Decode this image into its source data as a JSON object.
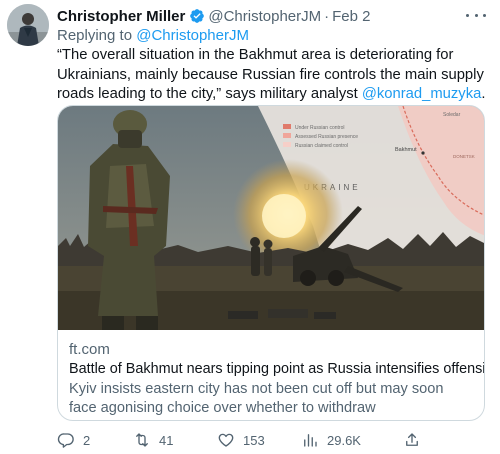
{
  "tweet": {
    "author_name": "Christopher Miller",
    "handle": "@ChristopherJM",
    "separator": "·",
    "date": "Feb 2",
    "reply_prefix": "Replying to",
    "reply_to": "@ChristopherJM",
    "text_main": "“The overall situation in the Bakhmut area is deteriorating for Ukrainians, mainly because Russian fire controls the main supply roads leading to the city,” says military analyst",
    "mention": "@konrad_muzyka",
    "text_end": ".",
    "verified_color": "#1d9bf0",
    "link_color": "#1d9bf0"
  },
  "card": {
    "domain": "ft.com",
    "title": "Battle of Bakhmut nears tipping point as Russia intensifies offensive",
    "description": "Kyiv insists eastern city has not been cut off but may soon face agonising choice over whether to withdraw",
    "map": {
      "country_label": "UKRAINE",
      "city_label": "Bakhmut",
      "legend_items": [
        "Under Russian control",
        "Assessed Russian presence",
        "Russian claimed control"
      ],
      "region_labels": [
        "Soledar",
        "DONETSK"
      ]
    }
  },
  "actions": {
    "replies": "2",
    "retweets": "41",
    "likes": "153",
    "views": "29.6K"
  },
  "icons": {
    "more": "more-dots-icon",
    "verified": "verified-badge-icon",
    "reply": "reply-icon",
    "retweet": "retweet-icon",
    "like": "heart-icon",
    "views": "analytics-icon",
    "share": "share-icon"
  }
}
